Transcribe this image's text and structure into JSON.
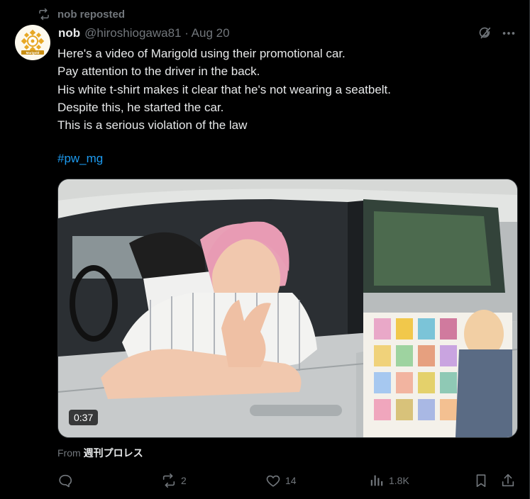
{
  "repost": {
    "label": "nob reposted"
  },
  "tweet": {
    "author_name": "nob",
    "handle_date": "@hiroshiogawa81 · Aug 20",
    "lines": [
      "Here's a video of Marigold using their promotional car.",
      "Pay attention to the driver in the back.",
      "His white t-shirt makes it clear that he's not wearing a seatbelt.",
      "Despite this, he started the car.",
      "This is a serious violation of the law"
    ],
    "hashtag": "#pw_mg",
    "avatar_logo_text": "Marigold"
  },
  "media": {
    "duration": "0:37"
  },
  "source": {
    "prefix": "From",
    "name": "週刊プロレス"
  },
  "actions": {
    "reply": {
      "icon": "reply-icon",
      "count": ""
    },
    "repost": {
      "icon": "repost-icon",
      "count": "2"
    },
    "like": {
      "icon": "heart-icon",
      "count": "14"
    },
    "views": {
      "icon": "views-icon",
      "count": "1.8K"
    },
    "bookmark": {
      "icon": "bookmark-icon"
    },
    "share": {
      "icon": "share-icon"
    }
  },
  "colors": {
    "background": "#000000",
    "text": "#e7e9ea",
    "muted": "#71767b",
    "link": "#1d9bf0"
  }
}
